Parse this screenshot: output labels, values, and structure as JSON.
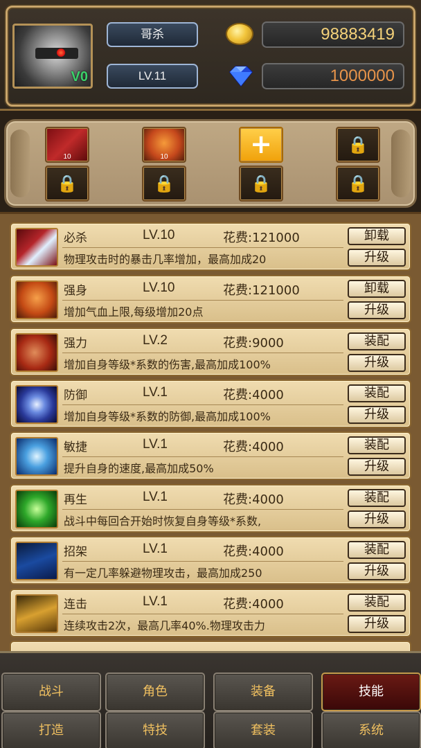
{
  "player": {
    "name": "哥杀",
    "level": "LV.11",
    "vip": "V0",
    "gold": "98883419",
    "gems": "1000000"
  },
  "icons": {
    "gold": "gold-coin-icon",
    "gem": "blue-diamond-icon",
    "lock": "padlock-icon",
    "plus": "plus-icon"
  },
  "slots": [
    {
      "type": "skill",
      "icon": "bisha-skill-icon",
      "count": "10"
    },
    {
      "type": "skill",
      "icon": "qiangshen-skill-icon",
      "count": "10"
    },
    {
      "type": "add",
      "icon": "plus-icon"
    },
    {
      "type": "locked",
      "icon": "padlock-icon"
    },
    {
      "type": "locked",
      "icon": "padlock-icon"
    },
    {
      "type": "locked",
      "icon": "padlock-icon"
    },
    {
      "type": "locked",
      "icon": "padlock-icon"
    },
    {
      "type": "locked",
      "icon": "padlock-icon"
    }
  ],
  "skills": [
    {
      "name": "必杀",
      "level": "LV.10",
      "cost": "花费:121000",
      "desc": "物理攻击时的暴击几率增加，最高加成20",
      "primary": "卸载",
      "secondary": "升级"
    },
    {
      "name": "强身",
      "level": "LV.10",
      "cost": "花费:121000",
      "desc": "增加气血上限,每级增加20点",
      "primary": "卸载",
      "secondary": "升级"
    },
    {
      "name": "强力",
      "level": "LV.2",
      "cost": "花费:9000",
      "desc": "增加自身等级*系数的伤害,最高加成100%",
      "primary": "装配",
      "secondary": "升级"
    },
    {
      "name": "防御",
      "level": "LV.1",
      "cost": "花费:4000",
      "desc": "增加自身等级*系数的防御,最高加成100%",
      "primary": "装配",
      "secondary": "升级"
    },
    {
      "name": "敏捷",
      "level": "LV.1",
      "cost": "花费:4000",
      "desc": "提升自身的速度,最高加成50%",
      "primary": "装配",
      "secondary": "升级"
    },
    {
      "name": "再生",
      "level": "LV.1",
      "cost": "花费:4000",
      "desc": "战斗中每回合开始时恢复自身等级*系数,",
      "primary": "装配",
      "secondary": "升级"
    },
    {
      "name": "招架",
      "level": "LV.1",
      "cost": "花费:4000",
      "desc": "有一定几率躲避物理攻击，最高加成250",
      "primary": "装配",
      "secondary": "升级"
    },
    {
      "name": "连击",
      "level": "LV.1",
      "cost": "花费:4000",
      "desc": "连续攻击2次，最高几率40%.物理攻击力",
      "primary": "装配",
      "secondary": "升级"
    }
  ],
  "nav": {
    "row1": [
      "战斗",
      "角色",
      "装备",
      "技能"
    ],
    "row2": [
      "打造",
      "特技",
      "套装",
      "系统"
    ],
    "active": "技能"
  },
  "colors": {
    "gold_text": "#f5d27a",
    "gem_text": "#e8944a",
    "nav_text": "#f0c060",
    "active_tab": "#6a1a14"
  }
}
